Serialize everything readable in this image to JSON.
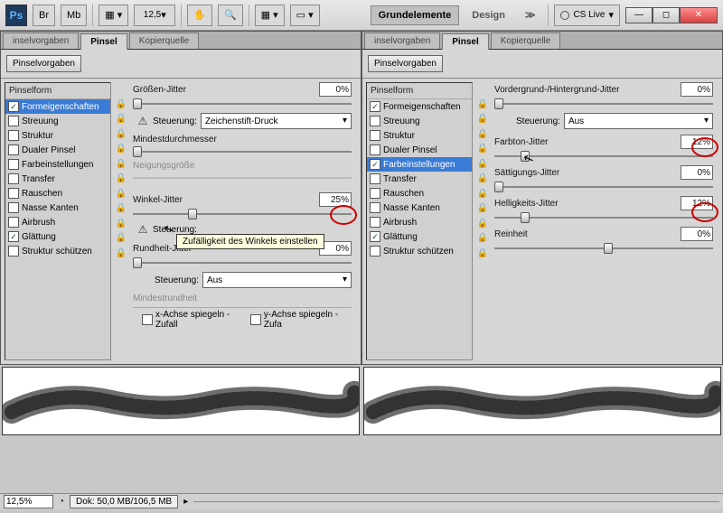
{
  "toolbar": {
    "ps": "Ps",
    "br": "Br",
    "mb": "Mb",
    "zoom": "12,5",
    "ws_active": "Grundelemente",
    "ws_design": "Design",
    "more": "≫",
    "cslive": "CS Live"
  },
  "tabs": {
    "vorgaben": "inselvorgaben",
    "pinsel": "Pinsel",
    "kopier": "Kopierquelle"
  },
  "btn_presets": "Pinselvorgaben",
  "list_head": "Pinselform",
  "list": [
    "Formeigenschaften",
    "Streuung",
    "Struktur",
    "Dualer Pinsel",
    "Farbeinstellungen",
    "Transfer",
    "Rauschen",
    "Nasse Kanten",
    "Airbrush",
    "Glättung",
    "Struktur schützen"
  ],
  "checks_left": [
    true,
    false,
    false,
    false,
    false,
    false,
    false,
    false,
    false,
    true,
    false
  ],
  "checks_right": [
    true,
    false,
    false,
    false,
    true,
    false,
    false,
    false,
    false,
    true,
    false
  ],
  "panel_left": {
    "groessen_label": "Größen-Jitter",
    "groessen_val": "0%",
    "steuerung": "Steuerung:",
    "stift_option": "Zeichenstift-Druck",
    "mindest_label": "Mindestdurchmesser",
    "neigung_label": "Neigungsgröße",
    "winkel_label": "Winkel-Jitter",
    "winkel_val": "25%",
    "rund_label": "Rundheit-Jitter",
    "rund_val": "0%",
    "mindestrund_label": "Mindestrundheit",
    "aus_option": "Aus",
    "flipx": "x-Achse spiegeln - Zufall",
    "flipy": "y-Achse spiegeln - Zufa",
    "tooltip": "Zufälligkeit des Winkels einstellen"
  },
  "panel_right": {
    "vg_label": "Vordergrund-/Hintergrund-Jitter",
    "vg_val": "0%",
    "steuerung": "Steuerung:",
    "aus_option": "Aus",
    "farbton_label": "Farbton-Jitter",
    "farbton_val": "12%",
    "satt_label": "Sättigungs-Jitter",
    "satt_val": "0%",
    "hell_label": "Helligkeits-Jitter",
    "hell_val": "12%",
    "rein_label": "Reinheit",
    "rein_val": "0%"
  },
  "status": {
    "zoom": "12,5%",
    "dok": "Dok: 50,0 MB/106,5 MB"
  }
}
